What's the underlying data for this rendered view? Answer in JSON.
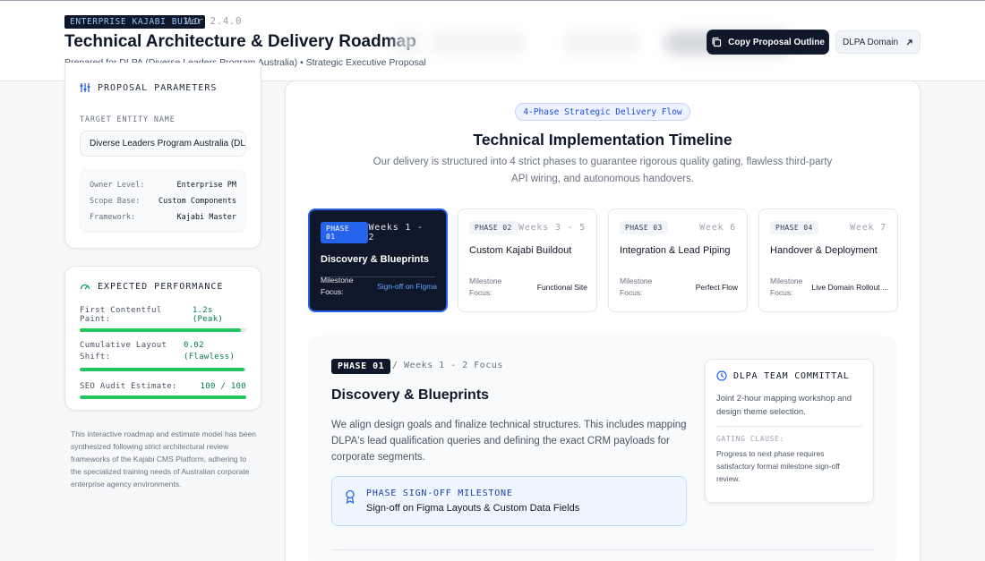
{
  "header": {
    "badge": "ENTERPRISE KAJABI BUILD",
    "version": "Ver 2.4.0",
    "title": "Technical Architecture & Delivery Roadmap",
    "subtitle": "Prepared for DLPA (Diverse Leaders Program Australia) • Strategic Executive Proposal",
    "copy_button": "Copy Proposal Outline",
    "domain_button": "DLPA Domain"
  },
  "parameters": {
    "heading": "PROPOSAL PARAMETERS",
    "target_label": "TARGET ENTITY NAME",
    "target_value": "Diverse Leaders Program Australia (DLPA)",
    "rows": [
      {
        "k": "Owner Level:",
        "v": "Enterprise PM"
      },
      {
        "k": "Scope Base:",
        "v": "Custom Components"
      },
      {
        "k": "Framework:",
        "v": "Kajabi Master"
      }
    ]
  },
  "performance": {
    "heading": "EXPECTED PERFORMANCE",
    "metrics": [
      {
        "label": "First Contentful Paint:",
        "value": "1.2s (Peak)",
        "fill": 0.97
      },
      {
        "label": "Cumulative Layout Shift:",
        "value": "0.02 (Flawless)",
        "fill": 0.99
      },
      {
        "label": "SEO Audit Estimate:",
        "value": "100 / 100",
        "fill": 1.0
      }
    ]
  },
  "side_note": "This interactive roadmap and estimate model has been synthesized following strict architectural review frameworks of the Kajabi CMS Platform, adhering to the specialized training needs of Australian corporate enterprise agency environments.",
  "timeline": {
    "pill": "4-Phase Strategic Delivery Flow",
    "title": "Technical Implementation Timeline",
    "description": "Our delivery is structured into 4 strict phases to guarantee rigorous quality gating, flawless third-party API wiring, and autonomous handovers.",
    "milestone_label": "Milestone Focus:",
    "phases": [
      {
        "tag": "PHASE 01",
        "weeks": "Weeks 1 - 2",
        "name": "Discovery & Blueprints",
        "milestone": "Sign-off on Figma"
      },
      {
        "tag": "PHASE 02",
        "weeks": "Weeks 3 - 5",
        "name": "Custom Kajabi Buildout",
        "milestone": "Functional Site"
      },
      {
        "tag": "PHASE 03",
        "weeks": "Week 6",
        "name": "Integration & Lead Piping",
        "milestone": "Perfect Flow"
      },
      {
        "tag": "PHASE 04",
        "weeks": "Week 7",
        "name": "Handover & Deployment",
        "milestone": "Live Domain Rollout ..."
      }
    ]
  },
  "detail": {
    "tag": "PHASE 01",
    "weeks": "/ Weeks 1 - 2 Focus",
    "title": "Discovery & Blueprints",
    "description": "We align design goals and finalize technical structures. This includes mapping DLPA's lead qualification queries and defining the exact CRM payloads for corporate segments.",
    "milestone_label": "PHASE SIGN-OFF MILESTONE",
    "milestone_text": "Sign-off on Figma Layouts & Custom Data Fields",
    "team_heading": "DLPA TEAM COMMITTAL",
    "team_text": "Joint 2-hour mapping workshop and design theme selection.",
    "gate_label": "GATING CLAUSE:",
    "gate_text": "Progress to next phase requires satisfactory formal milestone sign-off review."
  },
  "colors": {
    "accent": "#2563eb",
    "dark": "#0f172a",
    "success": "#22c55e"
  }
}
